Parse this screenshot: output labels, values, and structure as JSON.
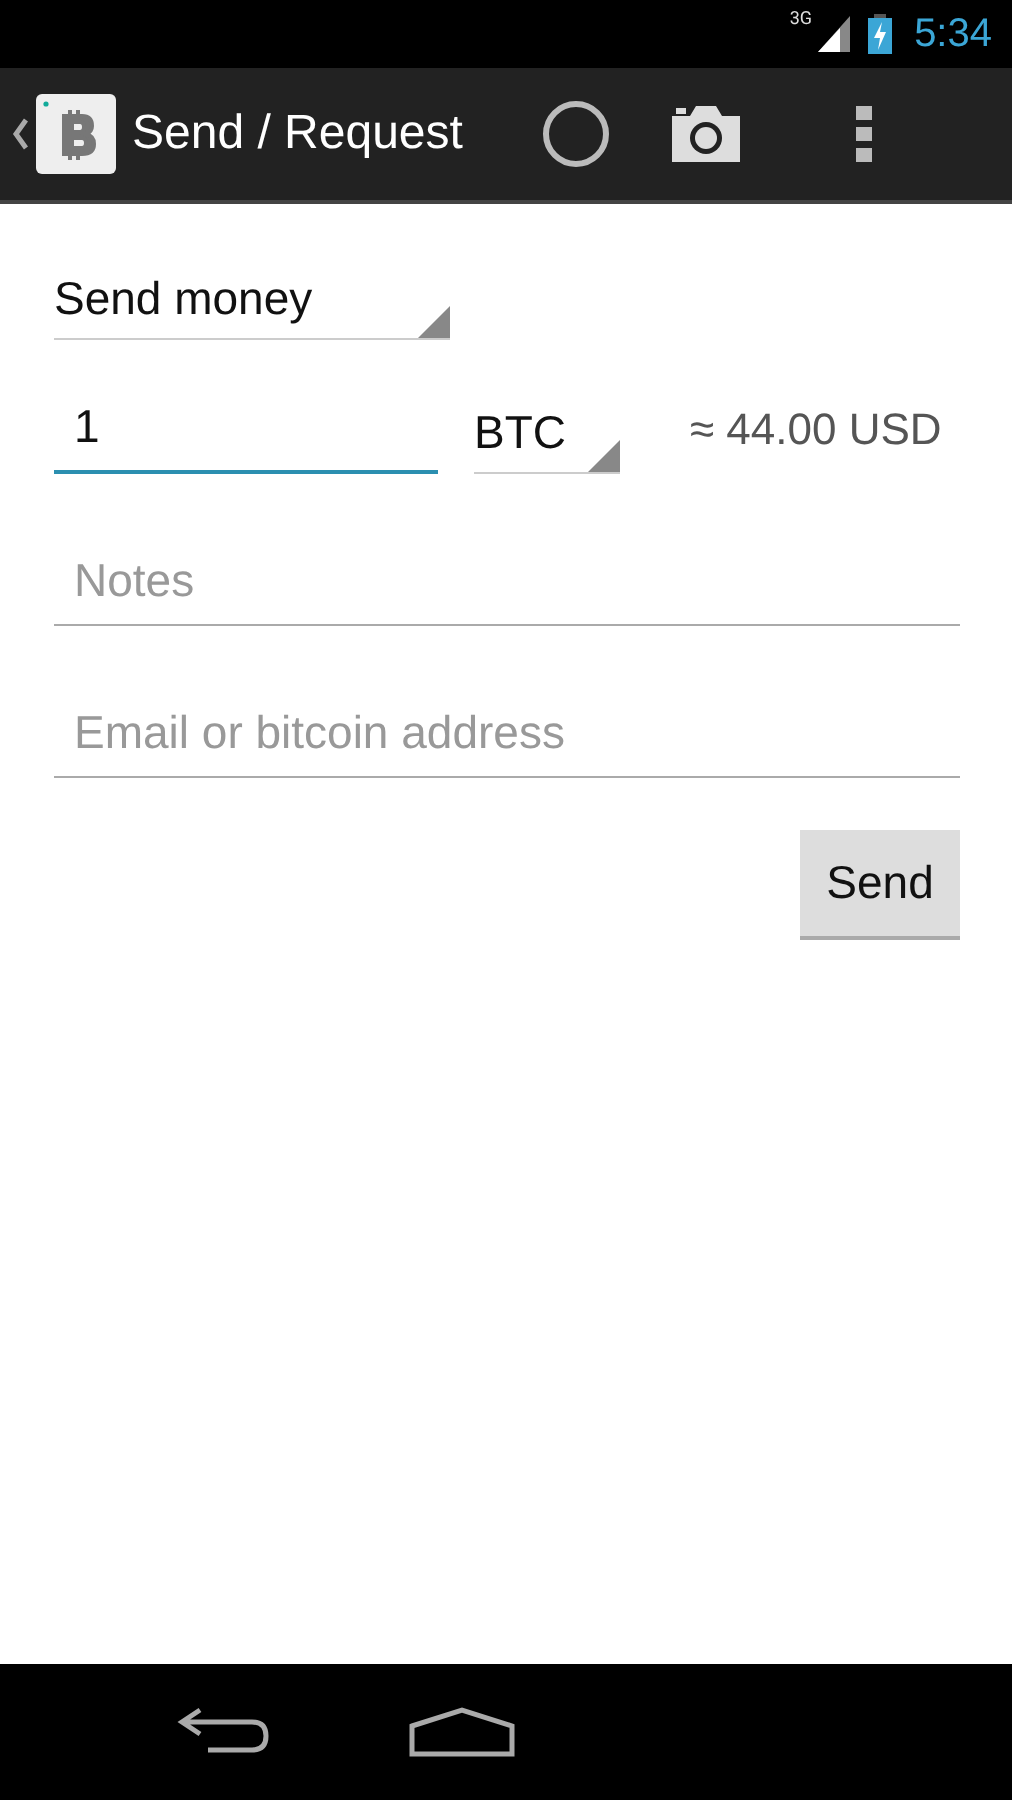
{
  "status_bar": {
    "network": "3G",
    "time": "5:34"
  },
  "action_bar": {
    "title": "Send / Request"
  },
  "form": {
    "mode": {
      "value": "Send money"
    },
    "amount": {
      "value": "1",
      "focused": true
    },
    "currency": {
      "value": "BTC"
    },
    "conversion": "≈ 44.00 USD",
    "notes": {
      "placeholder": "Notes"
    },
    "recipient": {
      "placeholder": "Email or bitcoin address"
    },
    "send_button": "Send"
  }
}
